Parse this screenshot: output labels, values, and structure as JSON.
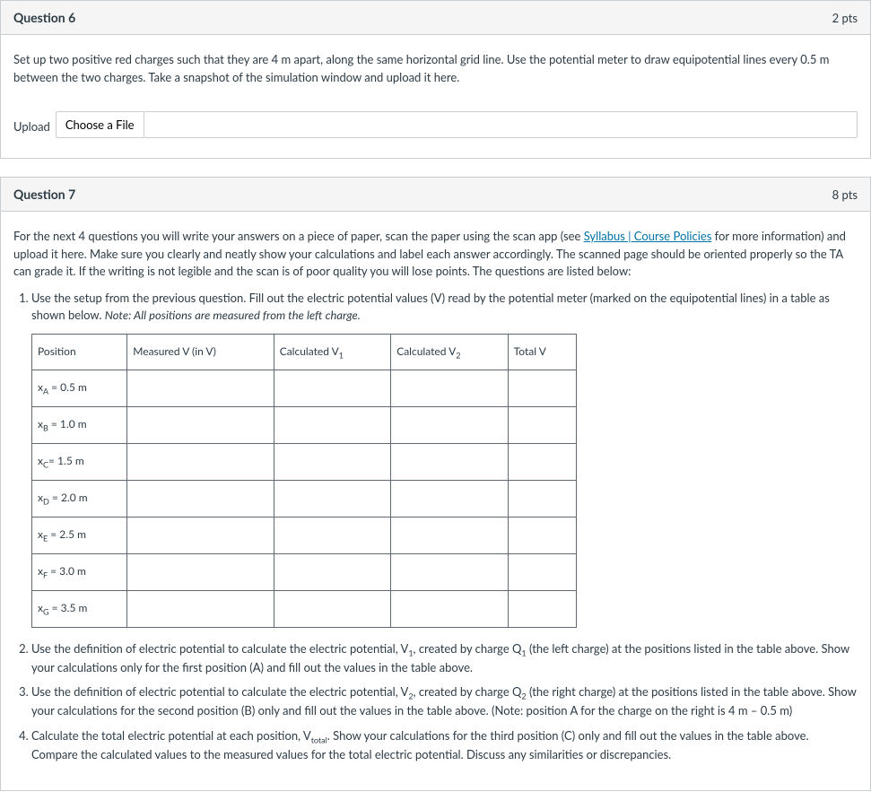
{
  "q6": {
    "title": "Question 6",
    "pts": "2 pts",
    "prompt": "Set up two positive red charges such that they are 4 m apart, along the same horizontal grid line. Use the potential meter to draw equipotential lines every 0.5 m between the two charges. Take a snapshot of the simulation window and upload it here.",
    "upload_label": "Upload",
    "choose_label": "Choose a File"
  },
  "q7": {
    "title": "Question 7",
    "pts": "8 pts",
    "intro_a": "For the next 4 questions you will write your answers on a piece of paper, scan the paper using the scan app (see ",
    "link_text": "Syllabus | Course Policies",
    "intro_b": " for more information) and upload it here. Make sure you clearly and neatly show your calculations and label each answer accordingly. The scanned page should be oriented properly so the TA can grade it. If the writing is not legible and the scan is of poor quality you will lose points. The questions are listed below:",
    "item1_a": "Use the setup from the previous question.  Fill out the electric potential values (V) read by the potential meter (marked on the equipotential lines) in a table as shown below. ",
    "item1_note": "Note: All positions are measured from the left charge.",
    "table": {
      "headers": {
        "position": "Position",
        "measured": "Measured V (in V)",
        "calcV1_a": "Calculated V",
        "calcV1_s": "1",
        "calcV2_a": "Calculated V",
        "calcV2_s": "2",
        "total": "Total V"
      },
      "rows": [
        {
          "p_a": "x",
          "p_s": "A",
          "p_b": " = 0.5 m"
        },
        {
          "p_a": "x",
          "p_s": "B",
          "p_b": " = 1.0 m"
        },
        {
          "p_a": "x",
          "p_s": "C",
          "p_b": "= 1.5 m"
        },
        {
          "p_a": "x",
          "p_s": "D",
          "p_b": " = 2.0 m"
        },
        {
          "p_a": "x",
          "p_s": "E",
          "p_b": " = 2.5 m"
        },
        {
          "p_a": "x",
          "p_s": "F",
          "p_b": " = 3.0 m"
        },
        {
          "p_a": "x",
          "p_s": "G",
          "p_b": " = 3.5 m"
        }
      ]
    },
    "item2_a": "Use the definition of electric potential to calculate the electric potential, V",
    "item2_s1": "1",
    "item2_b": ", created by charge Q",
    "item2_s2": "1",
    "item2_c": " (the left charge) at the positions listed in the table above. Show your calculations only for the first position (A) and fill out the values in the table above.",
    "item3_a": "Use the definition of electric potential to calculate the electric potential, V",
    "item3_s1": "2",
    "item3_b": ", created by charge Q",
    "item3_s2": "2",
    "item3_c": " (the right charge) at the positions listed in the table above. Show your calculations for the second position (B) only and fill out the values in the table above. (Note: position A for the charge on the right is 4 m – 0.5 m)",
    "item4_a": "Calculate the total electric potential at each position, V",
    "item4_s": "total",
    "item4_b": ". Show your calculations for the third position (C) only and fill out the values in the table above. Compare the calculated values to the measured values for the total electric potential. Discuss any similarities or discrepancies."
  }
}
